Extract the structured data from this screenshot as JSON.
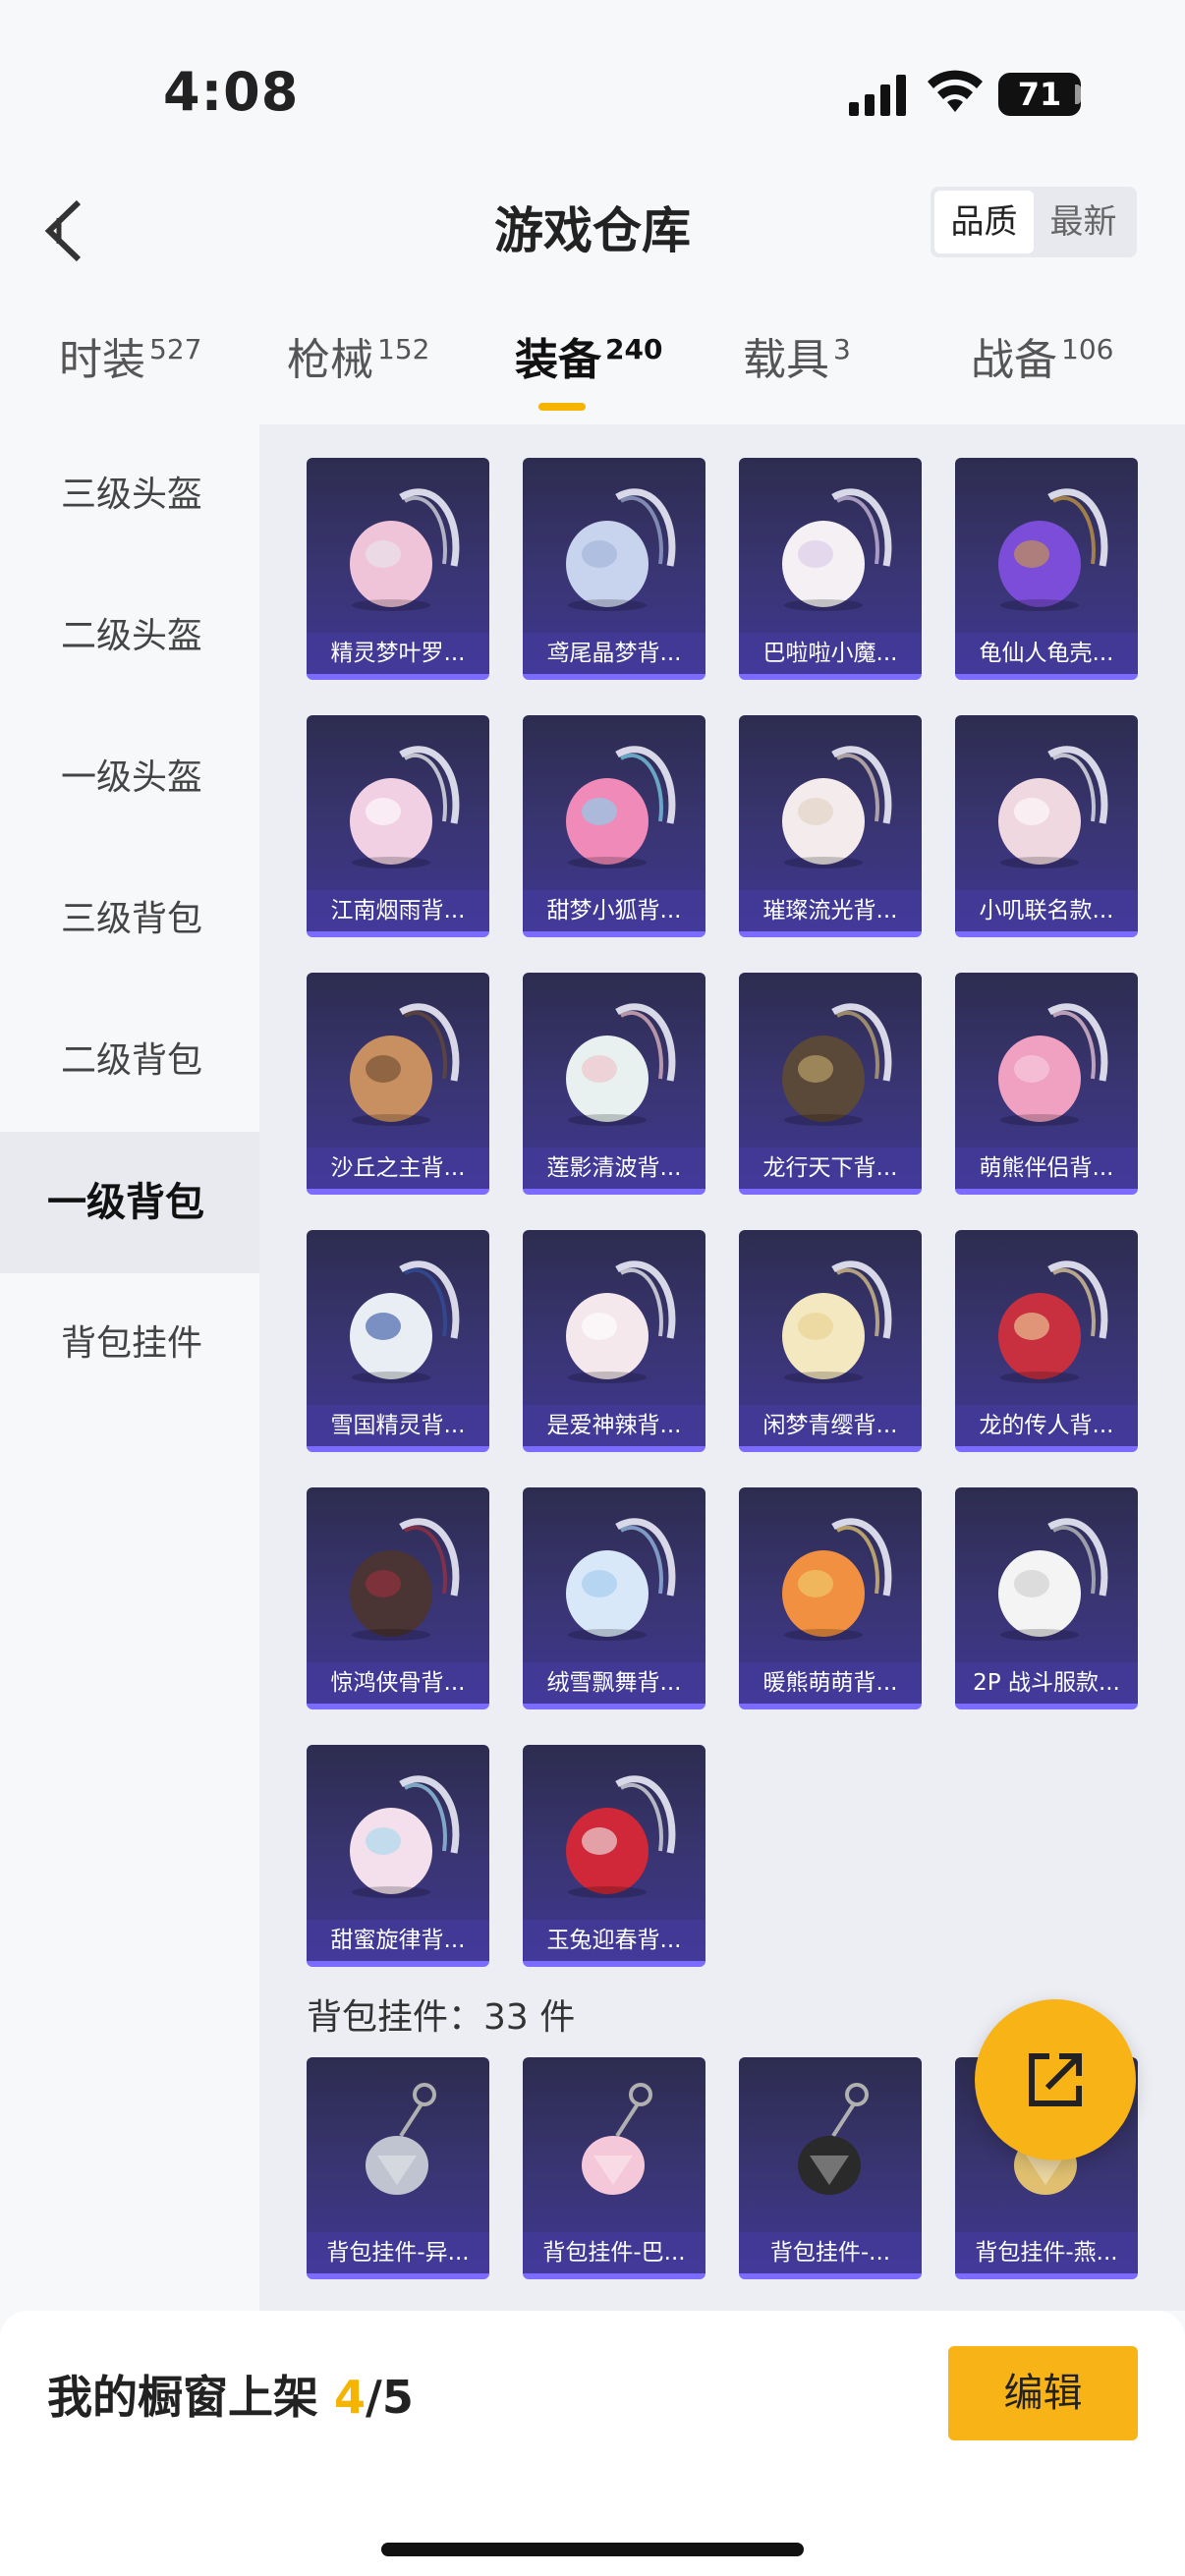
{
  "status": {
    "time": "4:08",
    "battery": "71"
  },
  "header": {
    "title": "游戏仓库",
    "sort_quality": "品质",
    "sort_latest": "最新"
  },
  "tabs": [
    {
      "label": "时装",
      "count": "527"
    },
    {
      "label": "枪械",
      "count": "152"
    },
    {
      "label": "装备",
      "count": "240"
    },
    {
      "label": "载具",
      "count": "3"
    },
    {
      "label": "战备",
      "count": "106"
    }
  ],
  "sidebar": [
    "三级头盔",
    "二级头盔",
    "一级头盔",
    "三级背包",
    "二级背包",
    "一级背包",
    "背包挂件"
  ],
  "items": [
    {
      "name": "精灵梦叶罗...",
      "icon": "heart-backpack-icon"
    },
    {
      "name": "鸢尾晶梦背...",
      "icon": "round-backpack-icon"
    },
    {
      "name": "巴啦啦小魔...",
      "icon": "white-backpack-icon"
    },
    {
      "name": "龟仙人龟壳...",
      "icon": "purple-backpack-icon"
    },
    {
      "name": "江南烟雨背...",
      "icon": "pink-lollipop-backpack-icon"
    },
    {
      "name": "甜梦小狐背...",
      "icon": "fox-backpack-icon"
    },
    {
      "name": "璀璨流光背...",
      "icon": "bow-backpack-icon"
    },
    {
      "name": "小叽联名款...",
      "icon": "plush-backpack-icon"
    },
    {
      "name": "沙丘之主背...",
      "icon": "scroll-backpack-icon"
    },
    {
      "name": "莲影清波背...",
      "icon": "dress-backpack-icon"
    },
    {
      "name": "龙行天下背...",
      "icon": "dragon-backpack-icon"
    },
    {
      "name": "萌熊伴侣背...",
      "icon": "bear-backpack-icon"
    },
    {
      "name": "雪国精灵背...",
      "icon": "snowman-backpack-icon"
    },
    {
      "name": "是爱神辣背...",
      "icon": "bunny-backpack-icon"
    },
    {
      "name": "闲梦青缨背...",
      "icon": "shell-backpack-icon"
    },
    {
      "name": "龙的传人背...",
      "icon": "red-backpack-icon"
    },
    {
      "name": "惊鸿侠骨背...",
      "icon": "dark-backpack-icon"
    },
    {
      "name": "绒雪飘舞背...",
      "icon": "blue-bow-backpack-icon"
    },
    {
      "name": "暖熊萌萌背...",
      "icon": "bear-box-backpack-icon"
    },
    {
      "name": "2P 战斗服款...",
      "icon": "battle-suit-backpack-icon"
    },
    {
      "name": "甜蜜旋律背...",
      "icon": "cupcake-backpack-icon"
    },
    {
      "name": "玉兔迎春背...",
      "icon": "rabbit-red-backpack-icon"
    }
  ],
  "pendant_section": "背包挂件：33 件",
  "pendants": [
    {
      "name": "背包挂件-异...",
      "icon": "wing-pendant-icon"
    },
    {
      "name": "背包挂件-巴...",
      "icon": "cat-pendant-icon"
    },
    {
      "name": "背包挂件-...",
      "icon": "snake-pendant-icon"
    },
    {
      "name": "背包挂件-燕...",
      "icon": "pendant-icon"
    }
  ],
  "bottom": {
    "label": "我的橱窗上架 ",
    "current": "4",
    "total": "/5",
    "edit": "编辑"
  },
  "colors": {
    "accent": "#f8b417",
    "card_bg": "#3a3574",
    "card_border": "#7b6cff"
  }
}
